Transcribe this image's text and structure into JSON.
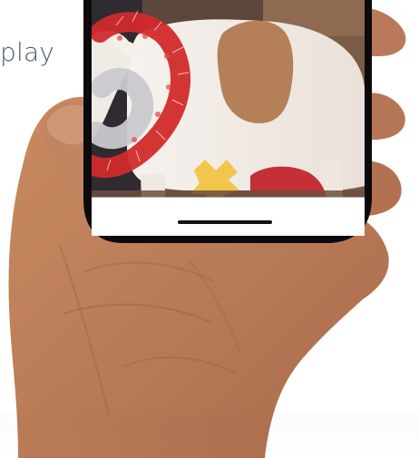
{
  "page": {
    "partial_text": "play"
  },
  "colors": {
    "background": "#ffffff",
    "text": "#4a5a66",
    "phone_frame": "#0b0b0d",
    "phone_bottom_bar": "#ffffff",
    "home_indicator": "#111111",
    "skin": "#b87a56",
    "sheep_wool": "#f3eee8",
    "sheep_patch": "#b57f57",
    "tinsel_red": "#d12a2b",
    "tinsel_silver": "#c9c9cf"
  },
  "icons": {
    "home_indicator": "home-indicator-bar"
  }
}
